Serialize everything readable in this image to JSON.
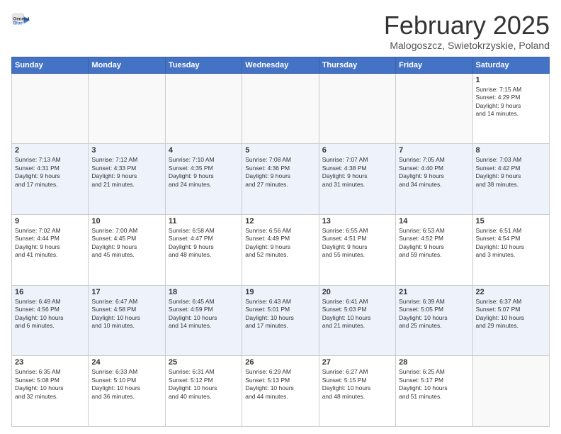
{
  "logo": {
    "general": "General",
    "blue": "Blue"
  },
  "title": "February 2025",
  "location": "Malogoszcz, Swietokrzyskie, Poland",
  "days_of_week": [
    "Sunday",
    "Monday",
    "Tuesday",
    "Wednesday",
    "Thursday",
    "Friday",
    "Saturday"
  ],
  "weeks": [
    [
      {
        "day": "",
        "info": ""
      },
      {
        "day": "",
        "info": ""
      },
      {
        "day": "",
        "info": ""
      },
      {
        "day": "",
        "info": ""
      },
      {
        "day": "",
        "info": ""
      },
      {
        "day": "",
        "info": ""
      },
      {
        "day": "1",
        "info": "Sunrise: 7:15 AM\nSunset: 4:29 PM\nDaylight: 9 hours\nand 14 minutes."
      }
    ],
    [
      {
        "day": "2",
        "info": "Sunrise: 7:13 AM\nSunset: 4:31 PM\nDaylight: 9 hours\nand 17 minutes."
      },
      {
        "day": "3",
        "info": "Sunrise: 7:12 AM\nSunset: 4:33 PM\nDaylight: 9 hours\nand 21 minutes."
      },
      {
        "day": "4",
        "info": "Sunrise: 7:10 AM\nSunset: 4:35 PM\nDaylight: 9 hours\nand 24 minutes."
      },
      {
        "day": "5",
        "info": "Sunrise: 7:08 AM\nSunset: 4:36 PM\nDaylight: 9 hours\nand 27 minutes."
      },
      {
        "day": "6",
        "info": "Sunrise: 7:07 AM\nSunset: 4:38 PM\nDaylight: 9 hours\nand 31 minutes."
      },
      {
        "day": "7",
        "info": "Sunrise: 7:05 AM\nSunset: 4:40 PM\nDaylight: 9 hours\nand 34 minutes."
      },
      {
        "day": "8",
        "info": "Sunrise: 7:03 AM\nSunset: 4:42 PM\nDaylight: 9 hours\nand 38 minutes."
      }
    ],
    [
      {
        "day": "9",
        "info": "Sunrise: 7:02 AM\nSunset: 4:44 PM\nDaylight: 9 hours\nand 41 minutes."
      },
      {
        "day": "10",
        "info": "Sunrise: 7:00 AM\nSunset: 4:45 PM\nDaylight: 9 hours\nand 45 minutes."
      },
      {
        "day": "11",
        "info": "Sunrise: 6:58 AM\nSunset: 4:47 PM\nDaylight: 9 hours\nand 48 minutes."
      },
      {
        "day": "12",
        "info": "Sunrise: 6:56 AM\nSunset: 4:49 PM\nDaylight: 9 hours\nand 52 minutes."
      },
      {
        "day": "13",
        "info": "Sunrise: 6:55 AM\nSunset: 4:51 PM\nDaylight: 9 hours\nand 55 minutes."
      },
      {
        "day": "14",
        "info": "Sunrise: 6:53 AM\nSunset: 4:52 PM\nDaylight: 9 hours\nand 59 minutes."
      },
      {
        "day": "15",
        "info": "Sunrise: 6:51 AM\nSunset: 4:54 PM\nDaylight: 10 hours\nand 3 minutes."
      }
    ],
    [
      {
        "day": "16",
        "info": "Sunrise: 6:49 AM\nSunset: 4:56 PM\nDaylight: 10 hours\nand 6 minutes."
      },
      {
        "day": "17",
        "info": "Sunrise: 6:47 AM\nSunset: 4:58 PM\nDaylight: 10 hours\nand 10 minutes."
      },
      {
        "day": "18",
        "info": "Sunrise: 6:45 AM\nSunset: 4:59 PM\nDaylight: 10 hours\nand 14 minutes."
      },
      {
        "day": "19",
        "info": "Sunrise: 6:43 AM\nSunset: 5:01 PM\nDaylight: 10 hours\nand 17 minutes."
      },
      {
        "day": "20",
        "info": "Sunrise: 6:41 AM\nSunset: 5:03 PM\nDaylight: 10 hours\nand 21 minutes."
      },
      {
        "day": "21",
        "info": "Sunrise: 6:39 AM\nSunset: 5:05 PM\nDaylight: 10 hours\nand 25 minutes."
      },
      {
        "day": "22",
        "info": "Sunrise: 6:37 AM\nSunset: 5:07 PM\nDaylight: 10 hours\nand 29 minutes."
      }
    ],
    [
      {
        "day": "23",
        "info": "Sunrise: 6:35 AM\nSunset: 5:08 PM\nDaylight: 10 hours\nand 32 minutes."
      },
      {
        "day": "24",
        "info": "Sunrise: 6:33 AM\nSunset: 5:10 PM\nDaylight: 10 hours\nand 36 minutes."
      },
      {
        "day": "25",
        "info": "Sunrise: 6:31 AM\nSunset: 5:12 PM\nDaylight: 10 hours\nand 40 minutes."
      },
      {
        "day": "26",
        "info": "Sunrise: 6:29 AM\nSunset: 5:13 PM\nDaylight: 10 hours\nand 44 minutes."
      },
      {
        "day": "27",
        "info": "Sunrise: 6:27 AM\nSunset: 5:15 PM\nDaylight: 10 hours\nand 48 minutes."
      },
      {
        "day": "28",
        "info": "Sunrise: 6:25 AM\nSunset: 5:17 PM\nDaylight: 10 hours\nand 51 minutes."
      },
      {
        "day": "",
        "info": ""
      }
    ]
  ]
}
